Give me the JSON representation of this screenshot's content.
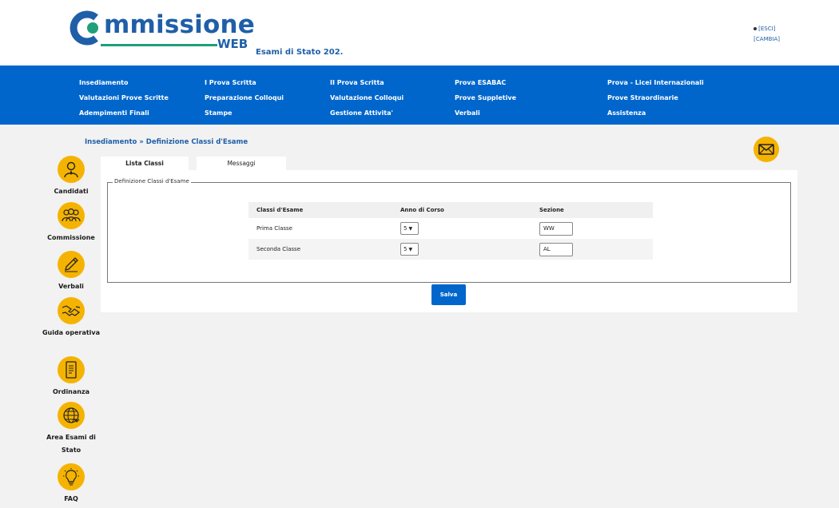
{
  "header": {
    "logo_word": "mmissione",
    "logo_web": "WEB",
    "subtitle": "Esami di Stato 202.",
    "links": [
      "[ESCI]",
      "[CAMBIA]"
    ],
    "brand_colors": {
      "blue": "#1f5fa8",
      "teal": "#1f9f7a",
      "accent": "#f5b301"
    }
  },
  "nav": {
    "columns": [
      [
        "Insediamento",
        "Valutazioni Prove Scritte",
        "Adempimenti Finali"
      ],
      [
        "I Prova Scritta",
        "Preparazione Colloqui",
        "Stampe"
      ],
      [
        "II Prova Scritta",
        "Valutazione Colloqui",
        "Gestione Attivita'"
      ],
      [
        "Prova ESABAC",
        "Prove Suppletive",
        "Verbali"
      ],
      [
        "Prova - Licei Internazionali",
        "Prove Straordinarie",
        "Assistenza"
      ]
    ]
  },
  "breadcrumb": "Insediamento » Definizione Classi d'Esame",
  "sidebar": {
    "items": [
      {
        "label": "Candidati",
        "icon": "user-icon"
      },
      {
        "label": "Commissione",
        "icon": "group-icon"
      },
      {
        "label": "Verbali",
        "icon": "pencil-icon"
      },
      {
        "label": "Guida operativa",
        "icon": "handshake-icon"
      },
      {
        "label": "Ordinanza",
        "icon": "document-icon"
      },
      {
        "label": "Area Esami di Stato",
        "icon": "globe-icon"
      },
      {
        "label": "FAQ",
        "icon": "lightbulb-icon"
      }
    ]
  },
  "tabs": [
    "Lista Classi",
    "Messaggi"
  ],
  "section": {
    "legend": "Definizione Classi d'Esame",
    "columns": [
      "Classi d'Esame",
      "Anno di Corso",
      "Sezione"
    ],
    "rows": [
      {
        "classe": "Prima Classe",
        "anno": "5",
        "sezione": "WW"
      },
      {
        "classe": "Seconda Classe",
        "anno": "5",
        "sezione": "AL"
      }
    ],
    "save_label": "Salva"
  }
}
